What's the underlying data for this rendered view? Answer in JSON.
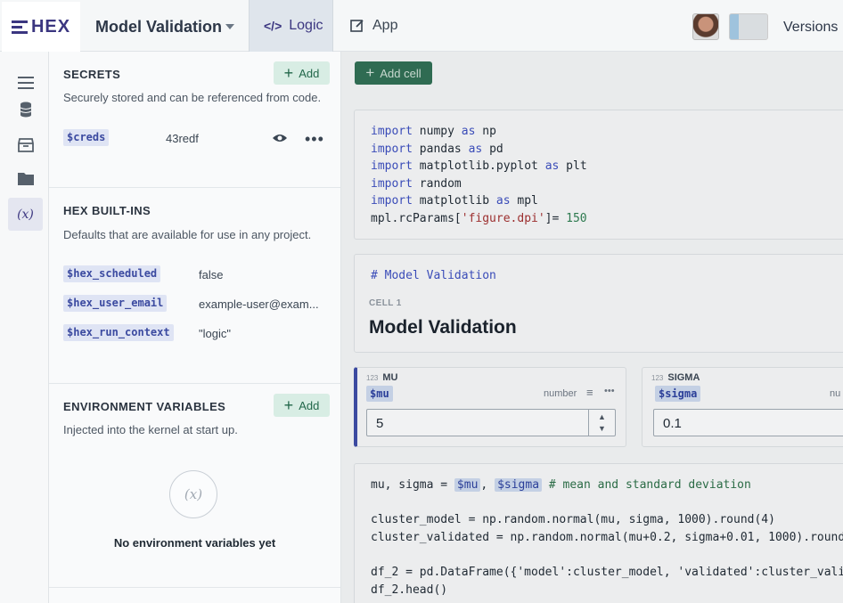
{
  "topbar": {
    "logo": "HEX",
    "project_title": "Model Validation",
    "tab_logic": "Logic",
    "tab_logic_icon": "</>",
    "tab_app": "App",
    "versions": "Versions"
  },
  "secrets": {
    "title": "SECRETS",
    "add": "Add",
    "description": "Securely stored and can be referenced from code.",
    "items": [
      {
        "name": "$creds",
        "value": "43redf"
      }
    ]
  },
  "builtins": {
    "title": "HEX BUILT-INS",
    "description": "Defaults that are available for use in any project.",
    "items": [
      {
        "name": "$hex_scheduled",
        "value": "false"
      },
      {
        "name": "$hex_user_email",
        "value": "example-user@exam..."
      },
      {
        "name": "$hex_run_context",
        "value": "\"logic\""
      }
    ]
  },
  "env": {
    "title": "ENVIRONMENT VARIABLES",
    "add": "Add",
    "description": "Injected into the kernel at start up.",
    "empty_icon": "(x)",
    "empty_text": "No environment variables yet"
  },
  "main": {
    "add_cell": "Add cell",
    "cell1_code": [
      "import numpy as np",
      "import pandas as pd",
      "import matplotlib.pyplot as plt",
      "import random",
      "import matplotlib as mpl",
      "mpl.rcParams['figure.dpi']= 150"
    ],
    "md_source": "# Model Validation",
    "md_label": "CELL 1",
    "md_heading": "Model Validation",
    "input_mu": {
      "type_code": "123",
      "label": "MU",
      "var": "$mu",
      "type": "number",
      "value": "5"
    },
    "input_sigma": {
      "type_code": "123",
      "label": "SIGMA",
      "var": "$sigma",
      "type": "nu",
      "value": "0.1"
    },
    "cell3_line1_prefix": "mu, sigma = ",
    "cell3_var_mu": "$mu",
    "cell3_var_sigma": "$sigma",
    "cell3_line1_comment": "# mean and standard deviation",
    "cell3_line2": "cluster_model = np.random.normal(mu, sigma, 1000).round(4)",
    "cell3_line3": "cluster_validated = np.random.normal(mu+0.2, sigma+0.01, 1000).round",
    "cell3_line4": "df_2 = pd.DataFrame({'model':cluster_model, 'validated':cluster_vali",
    "cell3_line5": "df_2.head()"
  }
}
